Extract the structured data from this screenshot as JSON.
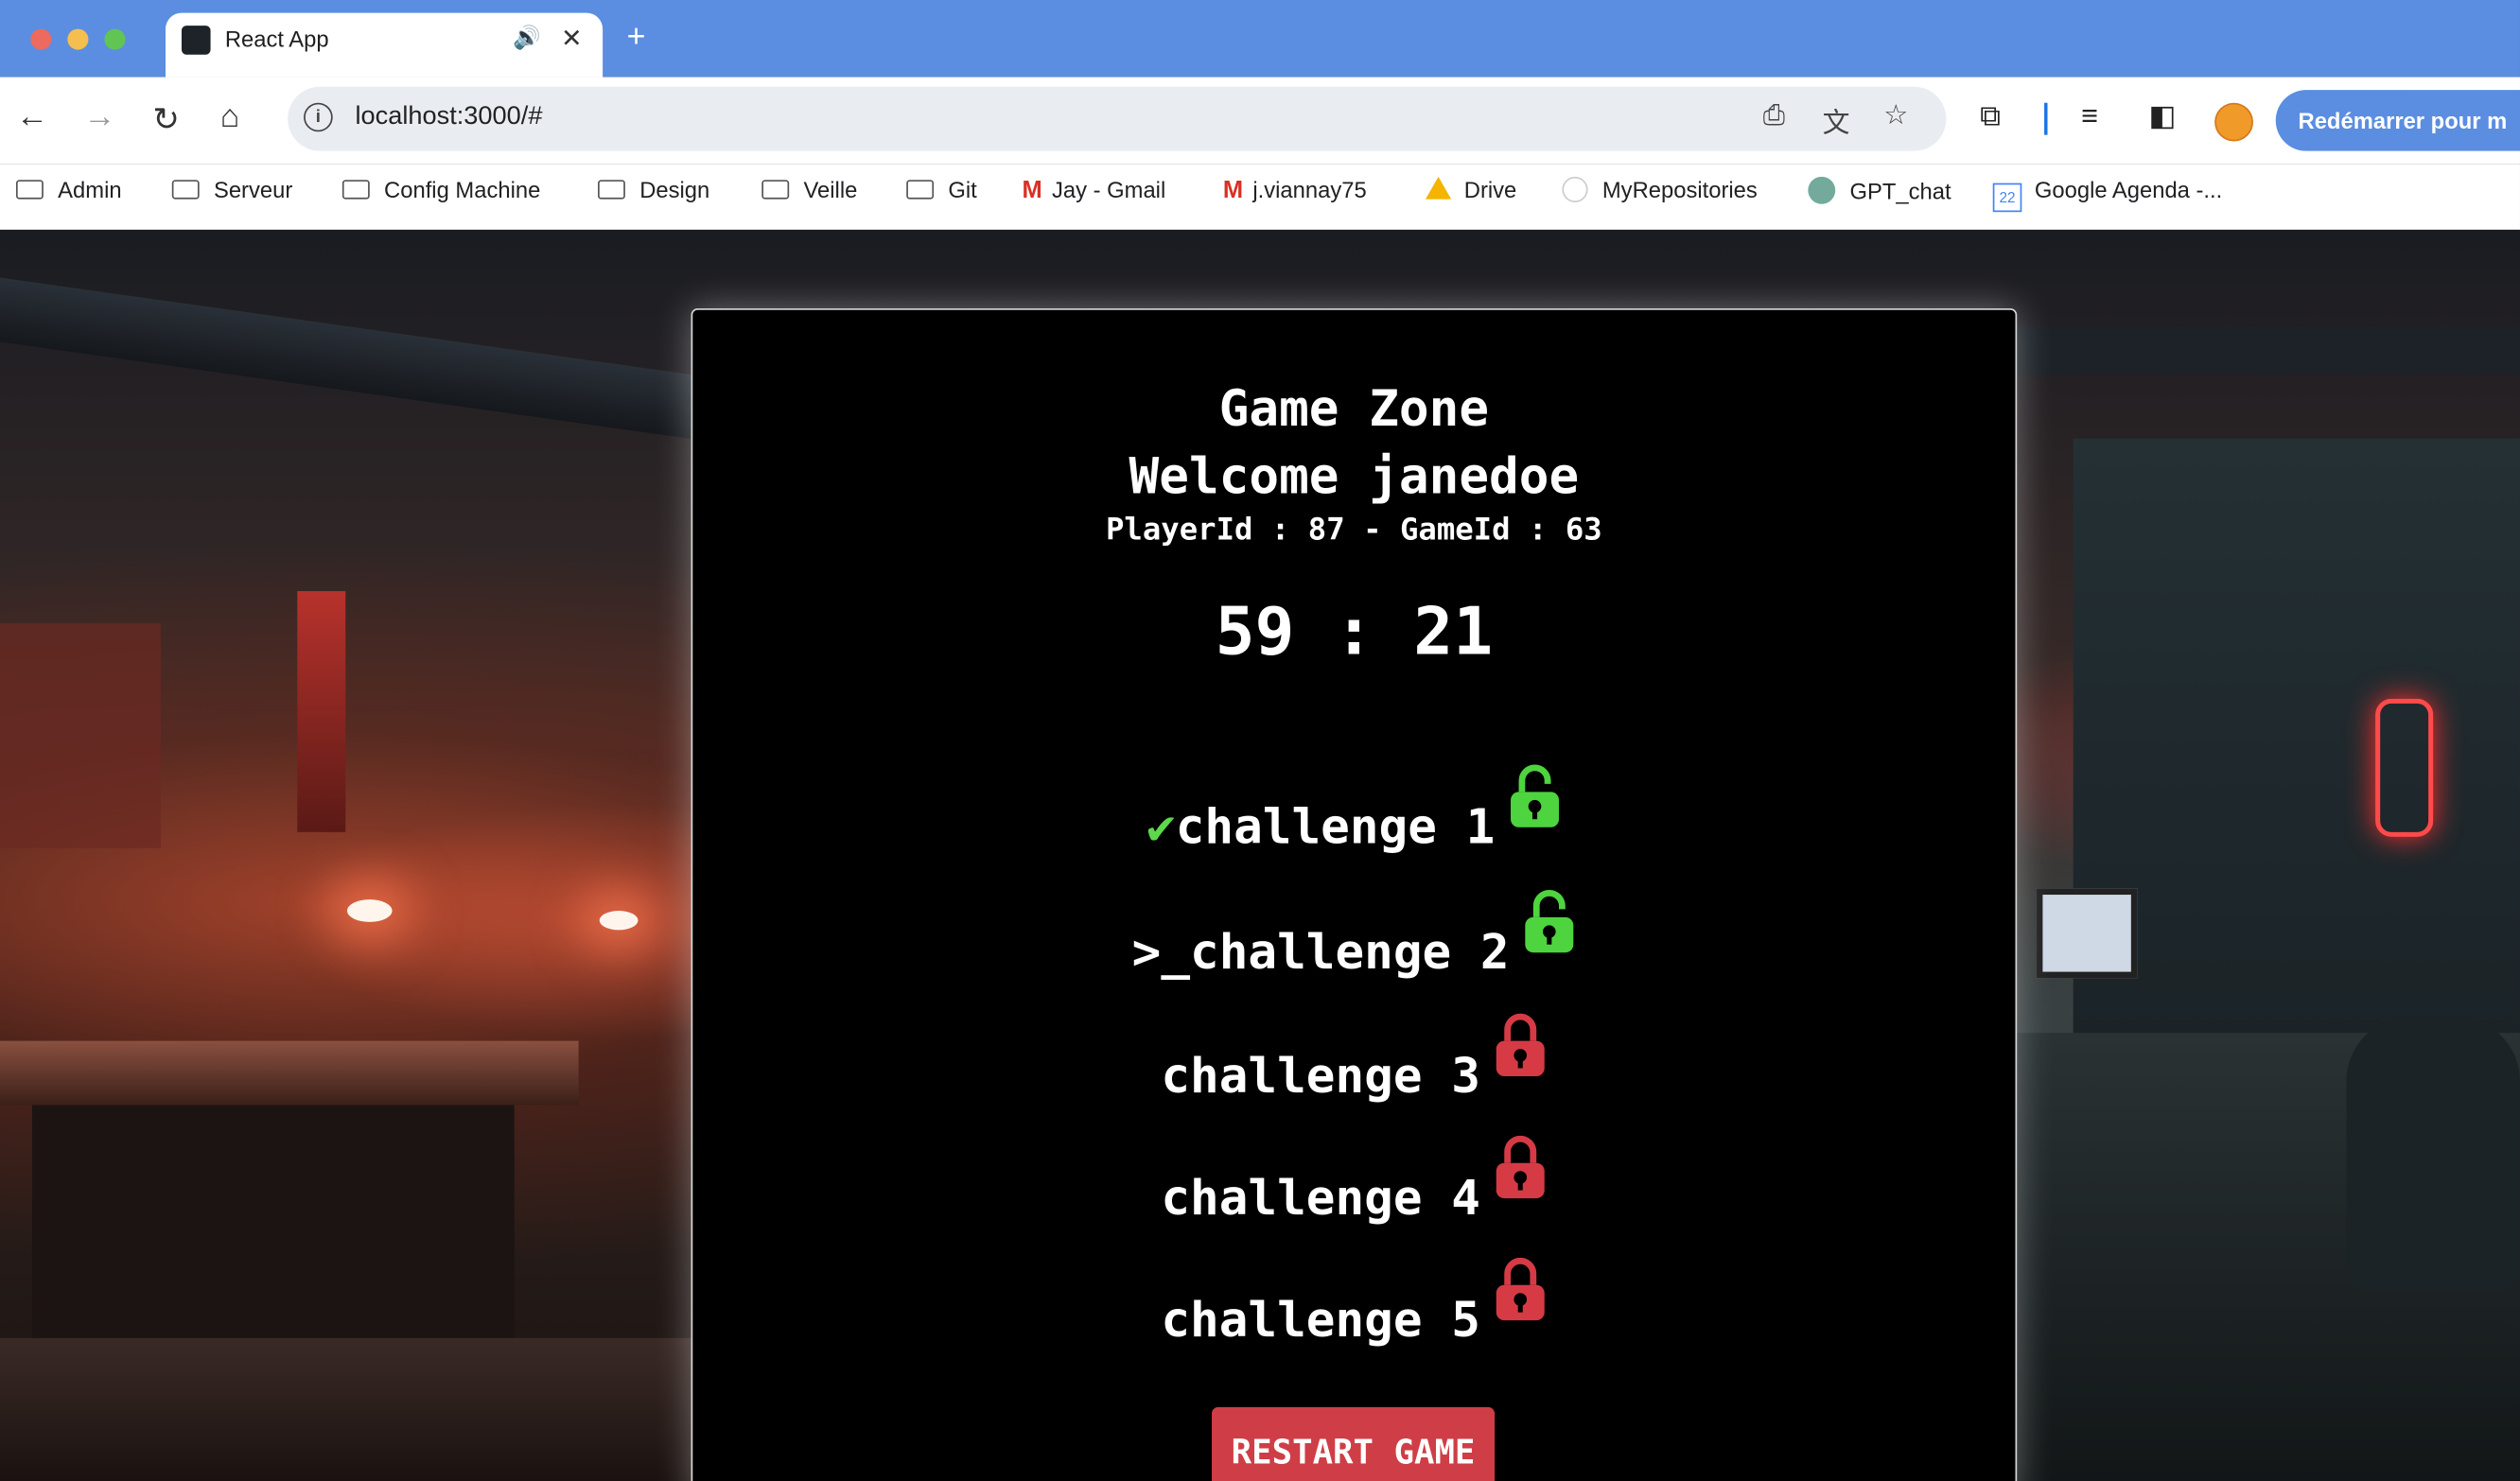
{
  "browser": {
    "tab": {
      "title": "React App"
    },
    "address": "localhost:3000/#",
    "restart_button": "Redémarrer pour m",
    "bookmarks": [
      {
        "label": "Admin",
        "icon": "folder-icon"
      },
      {
        "label": "Serveur",
        "icon": "folder-icon"
      },
      {
        "label": "Config Machine",
        "icon": "folder-icon"
      },
      {
        "label": "Design",
        "icon": "folder-icon"
      },
      {
        "label": "Veille",
        "icon": "folder-icon"
      },
      {
        "label": "Git",
        "icon": "folder-icon"
      },
      {
        "label": "Jay - Gmail",
        "icon": "gmail-icon"
      },
      {
        "label": "j.viannay75",
        "icon": "gmail-icon"
      },
      {
        "label": "Drive",
        "icon": "drive-icon"
      },
      {
        "label": "MyRepositories",
        "icon": "github-icon"
      },
      {
        "label": "GPT_chat",
        "icon": "openai-icon"
      },
      {
        "label": "Google Agenda -...",
        "icon": "calendar-icon"
      }
    ],
    "calendar_day": "22"
  },
  "game": {
    "title": "Game Zone",
    "welcome": "Welcome janedoe",
    "ids": "PlayerId : 87 - GameId : 63",
    "timer": "59 : 21",
    "challenges": [
      {
        "label": "challenge 1",
        "prefix": "✔",
        "status": "completed",
        "lock": "unlocked",
        "lock_color": "#4ed43e"
      },
      {
        "label": "challenge 2",
        "prefix": ">_",
        "status": "current",
        "lock": "unlocked",
        "lock_color": "#4ed43e"
      },
      {
        "label": "challenge 3",
        "prefix": "",
        "status": "locked",
        "lock": "locked",
        "lock_color": "#d63a45"
      },
      {
        "label": "challenge 4",
        "prefix": "",
        "status": "locked",
        "lock": "locked",
        "lock_color": "#d63a45"
      },
      {
        "label": "challenge 5",
        "prefix": "",
        "status": "locked",
        "lock": "locked",
        "lock_color": "#d63a45"
      }
    ],
    "restart_label": "RESTART GAME"
  }
}
